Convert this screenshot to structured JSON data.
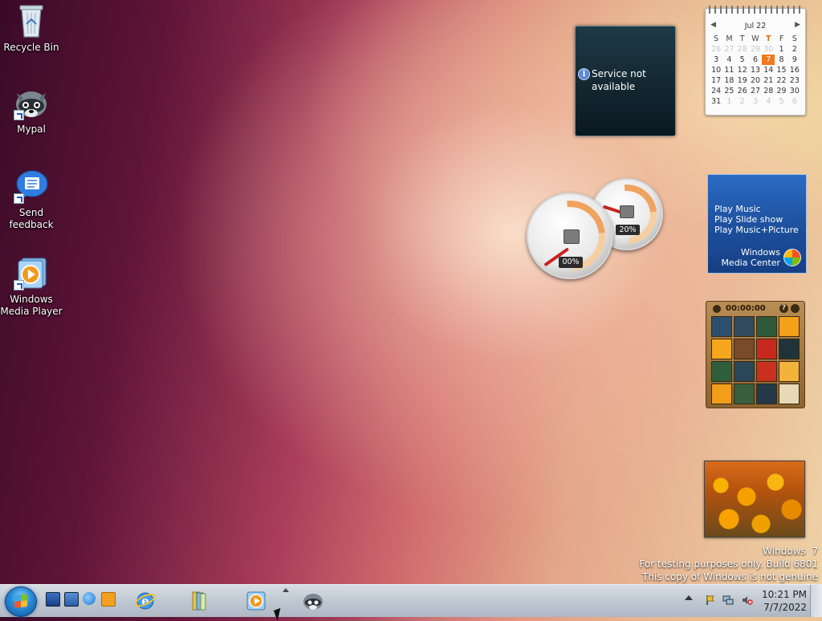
{
  "desktop": {
    "icons": [
      {
        "label": "Recycle Bin"
      },
      {
        "label": "Mypal"
      },
      {
        "label": "Send feedback"
      },
      {
        "label": "Windows Media Player"
      }
    ]
  },
  "gadgets": {
    "weather": {
      "message": "Service not available",
      "info_glyph": "i"
    },
    "calendar": {
      "month_label": "Jul 22",
      "weekdays": [
        "S",
        "M",
        "T",
        "W",
        "T",
        "F",
        "S"
      ],
      "weeks": [
        [
          "26",
          "27",
          "28",
          "29",
          "30",
          "1",
          "2"
        ],
        [
          "3",
          "4",
          "5",
          "6",
          "7",
          "8",
          "9"
        ],
        [
          "10",
          "11",
          "12",
          "13",
          "14",
          "15",
          "16"
        ],
        [
          "17",
          "18",
          "19",
          "20",
          "21",
          "22",
          "23"
        ],
        [
          "24",
          "25",
          "26",
          "27",
          "28",
          "29",
          "30"
        ],
        [
          "31",
          "1",
          "2",
          "3",
          "4",
          "5",
          "6"
        ]
      ],
      "today": "7"
    },
    "cpu_meter": {
      "cpu_percent": "00%",
      "memory_percent": "20%"
    },
    "media_center": {
      "links": [
        "Play Music",
        "Play Slide show",
        "Play Music+Picture"
      ],
      "brand_line1": "Windows",
      "brand_line2": "Media Center"
    },
    "puzzle": {
      "timer": "00:00:00",
      "help_glyph": "?"
    }
  },
  "watermark": {
    "line1": "Windows  7",
    "line2": "For testing purposes only. Build 6801",
    "line3": "This copy of Windows is not genuine"
  },
  "taskbar": {
    "clock_time": "10:21 PM",
    "clock_date": "7/7/2022"
  },
  "colors": {
    "today_highlight": "#f07a1f",
    "taskbar_top": "#d7dde4",
    "media_center_blue": "#1d4f9c"
  }
}
